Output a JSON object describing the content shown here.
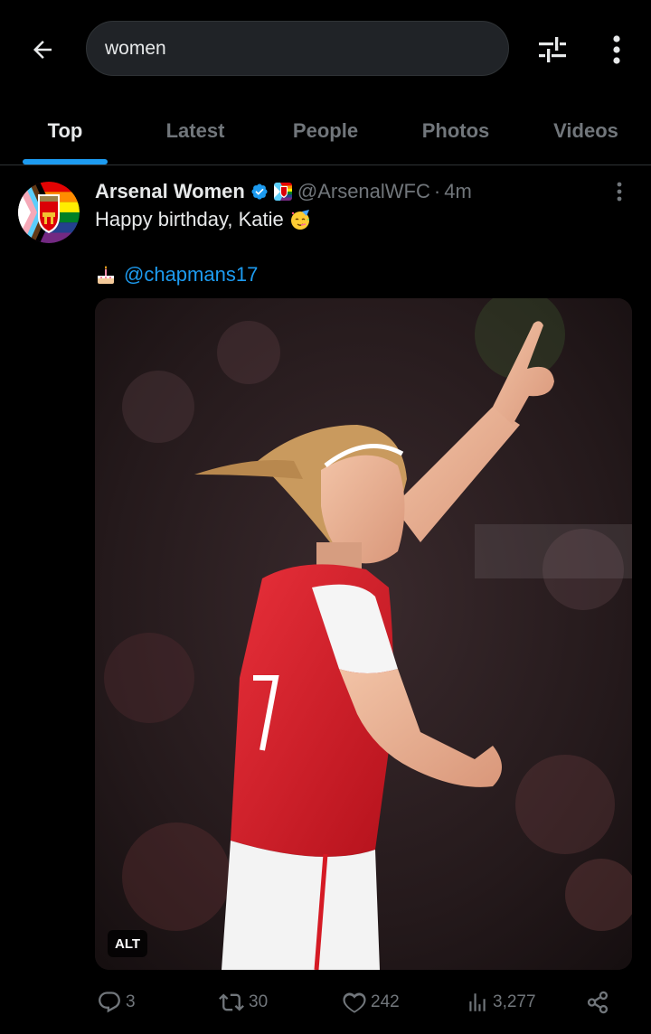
{
  "search": {
    "query": "women"
  },
  "tabs": [
    {
      "label": "Top",
      "active": true
    },
    {
      "label": "Latest",
      "active": false
    },
    {
      "label": "People",
      "active": false
    },
    {
      "label": "Photos",
      "active": false
    },
    {
      "label": "Videos",
      "active": false
    }
  ],
  "tweet": {
    "author_name": "Arsenal Women",
    "handle": "@ArsenalWFC",
    "separator": "·",
    "time": "4m",
    "text_line1": "Happy birthday, Katie",
    "mention": "@chapmans17",
    "avatar_label": "Arsenal",
    "media_alt_label": "ALT",
    "stats": {
      "replies": "3",
      "reposts": "30",
      "likes": "242",
      "views": "3,277"
    }
  },
  "colors": {
    "background": "#000000",
    "accent": "#1d9bf0",
    "text_primary": "#e7e9ea",
    "text_secondary": "#71767b",
    "search_bg": "#202327",
    "divider": "#2f3336"
  },
  "icons": {
    "back": "arrow-left-icon",
    "filter": "sliders-icon",
    "more": "more-vertical-icon",
    "verified": "verified-badge-icon",
    "reply": "reply-icon",
    "repost": "repost-icon",
    "like": "heart-icon",
    "views": "views-icon",
    "share": "share-icon",
    "emoji_party": "partying-face-icon",
    "emoji_cake": "birthday-cake-icon"
  }
}
